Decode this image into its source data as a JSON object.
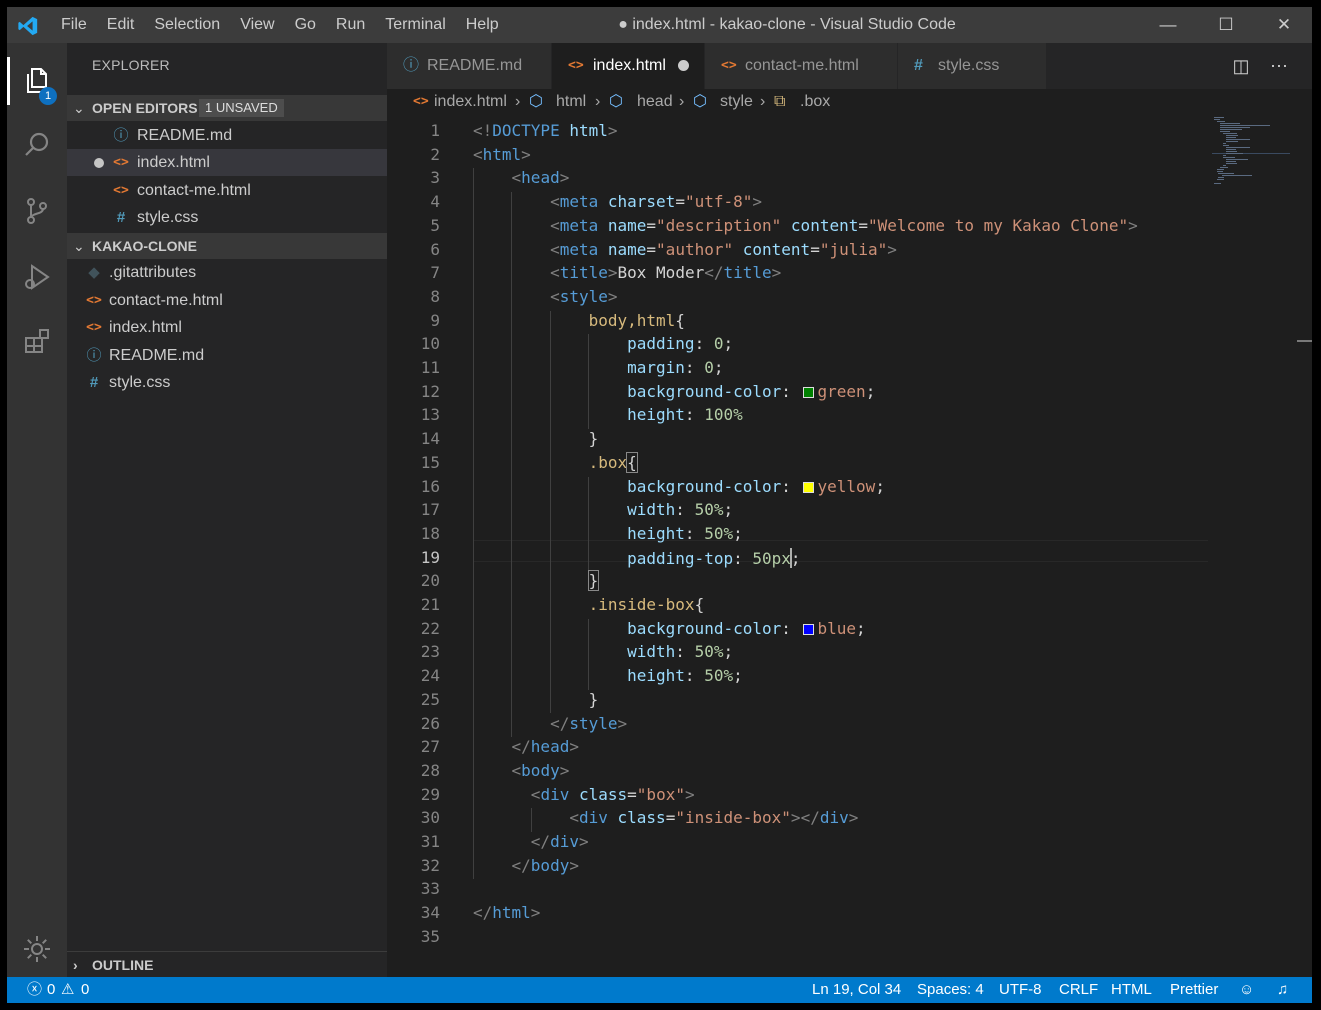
{
  "window": {
    "title": "● index.html - kakao-clone - Visual Studio Code",
    "menu": [
      "File",
      "Edit",
      "Selection",
      "View",
      "Go",
      "Run",
      "Terminal",
      "Help"
    ],
    "controls": {
      "minimize": "—",
      "maximize": "☐",
      "close": "✕"
    }
  },
  "activity_bar": {
    "explorer_badge": "1",
    "icons": [
      "files-icon",
      "search-icon",
      "source-control-icon",
      "run-debug-icon",
      "extensions-icon",
      "settings-gear-icon"
    ]
  },
  "sidebar": {
    "title": "EXPLORER",
    "open_editors": {
      "label": "OPEN EDITORS",
      "badge": "1 UNSAVED",
      "items": [
        {
          "name": "README.md",
          "icon": "info-icon"
        },
        {
          "name": "index.html",
          "icon": "html-icon",
          "modified": true
        },
        {
          "name": "contact-me.html",
          "icon": "html-icon"
        },
        {
          "name": "style.css",
          "icon": "css-icon"
        }
      ]
    },
    "project": {
      "label": "KAKAO-CLONE",
      "items": [
        {
          "name": ".gitattributes",
          "icon": "git-icon"
        },
        {
          "name": "contact-me.html",
          "icon": "html-icon"
        },
        {
          "name": "index.html",
          "icon": "html-icon"
        },
        {
          "name": "README.md",
          "icon": "info-icon"
        },
        {
          "name": "style.css",
          "icon": "css-icon"
        }
      ]
    },
    "outline_label": "OUTLINE"
  },
  "tabs": [
    {
      "label": "README.md",
      "icon": "ⓘ"
    },
    {
      "label": "index.html",
      "icon": "<>",
      "active": true
    },
    {
      "label": "contact-me.html",
      "icon": "<>"
    },
    {
      "label": "style.css",
      "icon": "#"
    }
  ],
  "breadcrumb": [
    "index.html",
    "html",
    "head",
    "style",
    ".box"
  ],
  "editor": {
    "line_numbers": [
      "1",
      "2",
      "3",
      "4",
      "5",
      "6",
      "7",
      "8",
      "9",
      "10",
      "11",
      "12",
      "13",
      "14",
      "15",
      "16",
      "17",
      "18",
      "19",
      "20",
      "21",
      "22",
      "23",
      "24",
      "25",
      "26",
      "27",
      "28",
      "29",
      "30",
      "31",
      "32",
      "33",
      "34",
      "35"
    ],
    "lines": [
      "<!DOCTYPE html>",
      "<html>",
      "    <head>",
      "        <meta charset=\"utf-8\">",
      "        <meta name=\"description\" content=\"Welcome to my Kakao Clone\">",
      "        <meta name=\"author\" content=\"julia\">",
      "        <title>Box Moder</title>",
      "        <style>",
      "            body,html{",
      "                padding: 0;",
      "                margin: 0;",
      "                background-color: green;",
      "                height: 100%",
      "            }",
      "            .box{",
      "                background-color: yellow;",
      "                width: 50%;",
      "                height: 50%;",
      "                padding-top: 50px;",
      "            }",
      "            .inside-box{",
      "                background-color: blue;",
      "                width: 50%;",
      "                height: 50%;",
      "            }",
      "        </style>",
      "    </head>",
      "    <body>",
      "      <div class=\"box\">",
      "          <div class=\"inside-box\"></div>",
      "      </div>",
      "    </body>",
      "",
      "</html>",
      ""
    ],
    "swatch_colors": {
      "green": "#008000",
      "yellow": "#ffff00",
      "blue": "#0000ff"
    }
  },
  "status_bar": {
    "errors": "0",
    "warnings": "0",
    "position": "Ln 19, Col 34",
    "spaces": "Spaces: 4",
    "encoding": "UTF-8",
    "eol": "CRLF",
    "language": "HTML",
    "formatter": "Prettier"
  }
}
